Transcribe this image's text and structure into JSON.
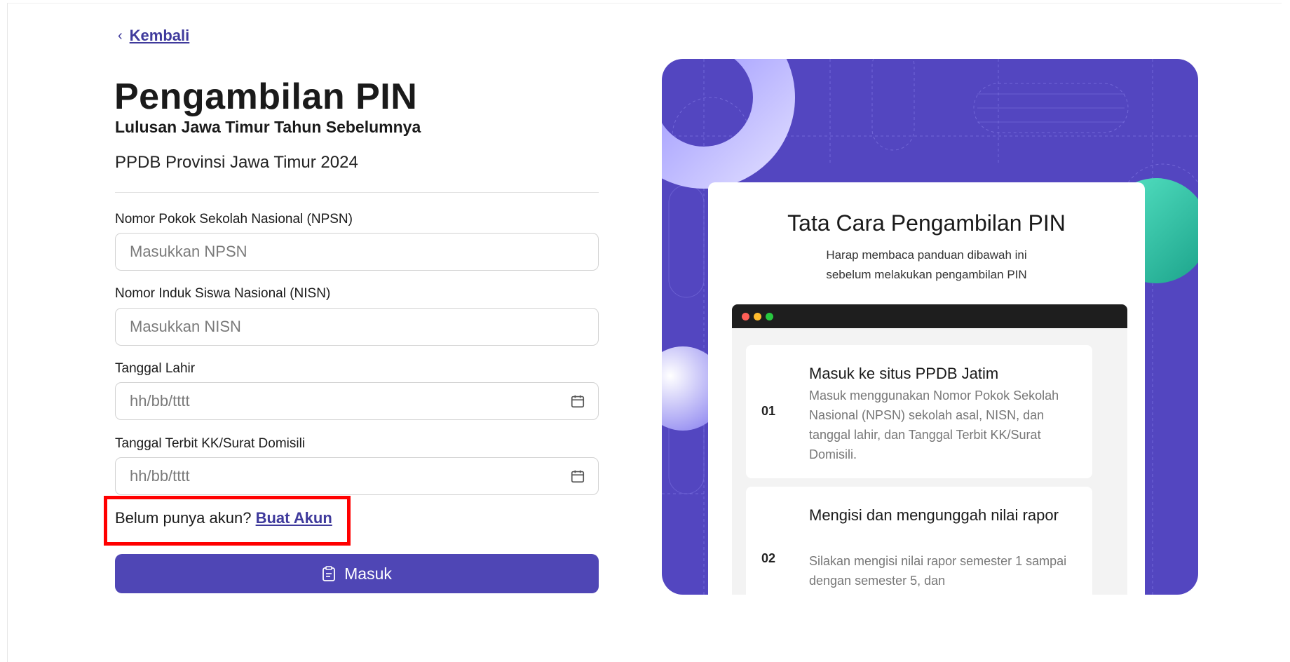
{
  "nav": {
    "back_label": "Kembali"
  },
  "header": {
    "title": "Pengambilan PIN",
    "subtitle": "Lulusan Jawa Timur Tahun Sebelumnya",
    "caption": "PPDB Provinsi Jawa Timur 2024"
  },
  "form": {
    "npsn": {
      "label": "Nomor Pokok Sekolah Nasional (NPSN)",
      "placeholder": "Masukkan NPSN",
      "value": ""
    },
    "nisn": {
      "label": "Nomor Induk Siswa Nasional (NISN)",
      "placeholder": "Masukkan NISN",
      "value": ""
    },
    "birthdate": {
      "label": "Tanggal Lahir",
      "placeholder": "hh/bb/tttt",
      "value": ""
    },
    "kk_date": {
      "label": "Tanggal Terbit KK/Surat Domisili",
      "placeholder": "hh/bb/tttt",
      "value": ""
    },
    "signup_prompt": "Belum punya akun?",
    "signup_link": "Buat Akun",
    "submit_label": "Masuk"
  },
  "guide": {
    "title": "Tata Cara Pengambilan PIN",
    "description_line1": "Harap membaca panduan dibawah ini",
    "description_line2": "sebelum melakukan pengambilan PIN",
    "steps": [
      {
        "number": "01",
        "title": "Masuk ke situs PPDB Jatim",
        "description": "Masuk menggunakan Nomor Pokok Sekolah Nasional (NPSN) sekolah asal, NISN, dan tanggal lahir, dan Tanggal Terbit KK/Surat Domisili."
      },
      {
        "number": "02",
        "title": "Mengisi dan mengunggah nilai rapor",
        "description": "Silakan mengisi nilai rapor semester 1 sampai dengan semester 5, dan"
      }
    ]
  },
  "colors": {
    "accent": "#4f46b5",
    "panel": "#5346c0",
    "link": "#3f3a9c",
    "highlight": "#ff0000",
    "teal": "#2fc7a8"
  },
  "icons": [
    "chevron-left-icon",
    "calendar-icon",
    "clipboard-icon"
  ]
}
